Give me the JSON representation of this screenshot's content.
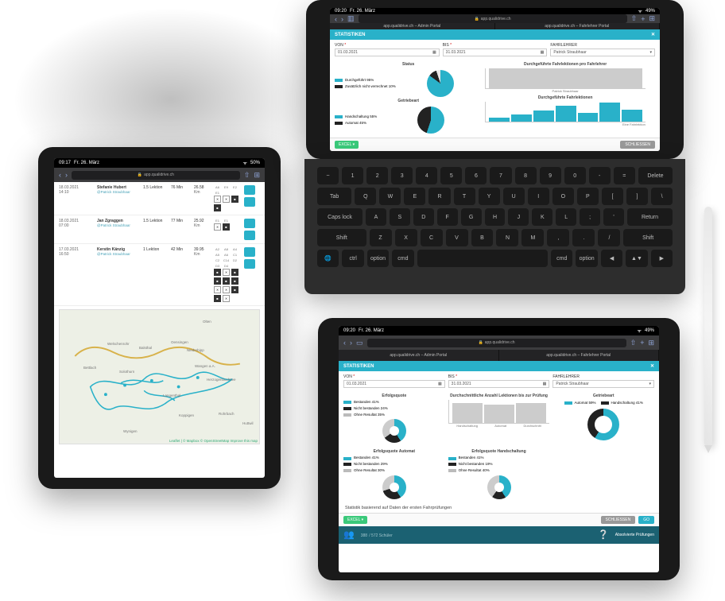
{
  "statusbar": {
    "time": "09:17",
    "time2": "09:20",
    "date": "Fr. 26. März",
    "battery": "50%",
    "battery2": "49%"
  },
  "safari": {
    "url": "app.qualidrive.ch",
    "tab_admin": "app.qualidrive.ch – Admin Portal",
    "tab_lehrer": "app.qualidrive.ch – Fahrlehrer Portal"
  },
  "stats_header": "STATISTIKEN",
  "filters": {
    "von_label": "VON",
    "von_value": "01.03.2021",
    "bis_label": "BIS",
    "bis_value": "31.03.2021",
    "lehrer_label": "FAHRLEHRER",
    "lehrer_value": "Patrick Straubhaar"
  },
  "top_panels": {
    "status_title": "Status",
    "status_legend": [
      {
        "label": "Durchgeführt",
        "pct": "95%",
        "color": "cyan"
      },
      {
        "label": "Zusätzlich nicht verrechnet",
        "pct": "10%",
        "color": "black"
      }
    ],
    "getriebe_title": "Getriebeart",
    "getriebe_legend": [
      {
        "label": "Handschaltung",
        "pct": "55%",
        "color": "cyan"
      },
      {
        "label": "Automat",
        "pct": "45%",
        "color": "black"
      }
    ],
    "chart1_title": "Durchgeführte Fahrlektionen pro Fahrlehrer",
    "chart1_x": "Patrick Straubhaar",
    "chart2_title": "Durchgeführte Fahrlektionen",
    "chart2_footer": "Eine Fahrlektion"
  },
  "bottom_panels": {
    "erfolg_title": "Erfolgsquote",
    "erfolg_legend": [
      {
        "label": "Bestanden",
        "pct": "41%",
        "color": "cyan"
      },
      {
        "label": "Nicht bestanden",
        "pct": "24%",
        "color": "black"
      },
      {
        "label": "Ohne Resultat",
        "pct": "35%",
        "color": "gray"
      }
    ],
    "lekt_title": "Durchschnittliche Anzahl Lektionen bis zur Prüfung",
    "lekt_cats": [
      "Handschaltung",
      "Automat",
      "Durchschnitt"
    ],
    "getriebe_title": "Getriebeart",
    "getriebe_legend": [
      {
        "label": "Automat",
        "pct": "59%",
        "color": "cyan"
      },
      {
        "label": "Handschaltung",
        "pct": "41%",
        "color": "black"
      }
    ],
    "auto_title": "Erfolgsquote Automat",
    "auto_legend": [
      {
        "label": "Bestanden",
        "pct": "41%",
        "color": "cyan"
      },
      {
        "label": "Nicht bestanden",
        "pct": "29%",
        "color": "black"
      },
      {
        "label": "Ohne Resultat",
        "pct": "30%",
        "color": "gray"
      }
    ],
    "hand_title": "Erfolgsquote Handschaltung",
    "hand_legend": [
      {
        "label": "Bestanden",
        "pct": "41%",
        "color": "cyan"
      },
      {
        "label": "Nicht bestanden",
        "pct": "19%",
        "color": "black"
      },
      {
        "label": "Ohne Resultat",
        "pct": "40%",
        "color": "gray"
      }
    ],
    "note": "Statistik basierend auf Daten der ersten Fahrprüfungen"
  },
  "buttons": {
    "excel": "EXCEL ▾",
    "close": "SCHLIESSEN",
    "go": "GO"
  },
  "appbar": {
    "count": "388",
    "total": "/ 572 Schüler",
    "menu": "Absolvierte Prüfungen"
  },
  "lessons": [
    {
      "date": "18.03.2021",
      "time": "14:10",
      "student": "Stefanie Hubert",
      "teacher": "@Patrick Straubhaar",
      "type": "1.5 Lektion",
      "duration": "76 Min",
      "price": "26.58",
      "unit": "Km",
      "codes": [
        "A6",
        "E9",
        "E2",
        "E1"
      ],
      "filled": [
        0,
        0,
        1,
        1
      ]
    },
    {
      "date": "18.03.2021",
      "time": "07:00",
      "student": "Jan Zgraggen",
      "teacher": "@Patrick Straubhaar",
      "type": "1.5 Lektion",
      "duration": "77 Min",
      "price": "25.92",
      "unit": "Km",
      "codes": [
        "E1",
        "E1"
      ],
      "filled": [
        0,
        1
      ]
    },
    {
      "date": "17.03.2021",
      "time": "16:50",
      "student": "Kerstin Känzig",
      "teacher": "@Patrick Straubhaar",
      "type": "1 Lektion",
      "duration": "42 Min",
      "price": "39.95",
      "unit": "Km",
      "codes": [
        "A2",
        "A8",
        "A4",
        "A5",
        "A6",
        "C1",
        "C2",
        "C14",
        "D2",
        "D3",
        "D4"
      ],
      "filled": [
        1,
        0,
        1,
        1,
        1,
        1,
        0,
        0,
        1,
        1,
        0
      ]
    }
  ],
  "map": {
    "cities": [
      "Olten",
      "Oensingen",
      "Niederbipp",
      "Wangen a.A.",
      "Herzogenbuchsee",
      "Langenthal",
      "Solothurn",
      "Welschenrohr",
      "Balsthal",
      "Bettlach",
      "Wynigen",
      "Huttwil",
      "Rohrbach",
      "Koppigen"
    ],
    "attribution": "Leaflet | © Mapbox © OpenStreetMap Improve this map"
  },
  "keyboard": {
    "r1": [
      "~",
      "1",
      "2",
      "3",
      "4",
      "5",
      "6",
      "7",
      "8",
      "9",
      "0",
      "-",
      "=",
      "Delete"
    ],
    "r2": [
      "Tab",
      "Q",
      "W",
      "E",
      "R",
      "T",
      "Y",
      "U",
      "I",
      "O",
      "P",
      "[",
      "]",
      "\\"
    ],
    "r3": [
      "Caps lock",
      "A",
      "S",
      "D",
      "F",
      "G",
      "H",
      "J",
      "K",
      "L",
      ";",
      "'",
      "Return"
    ],
    "r4": [
      "Shift",
      "Z",
      "X",
      "C",
      "V",
      "B",
      "N",
      "M",
      ",",
      ".",
      "/",
      "Shift"
    ],
    "r5": [
      "🌐",
      "ctrl",
      "option",
      "cmd",
      "",
      "cmd",
      "option",
      "◀",
      "▲▼",
      "▶"
    ]
  },
  "chart_data": [
    {
      "type": "pie",
      "title": "Status",
      "series": [
        {
          "name": "Durchgeführt",
          "value": 95
        },
        {
          "name": "Zusätzlich nicht verrechnet",
          "value": 10
        }
      ]
    },
    {
      "type": "pie",
      "title": "Getriebeart (top)",
      "series": [
        {
          "name": "Handschaltung",
          "value": 55
        },
        {
          "name": "Automat",
          "value": 45
        }
      ]
    },
    {
      "type": "bar",
      "title": "Durchgeführte Fahrlektionen pro Fahrlehrer",
      "categories": [
        "Patrick Straubhaar"
      ],
      "values": [
        100
      ],
      "ylim": [
        0,
        100
      ]
    },
    {
      "type": "bar",
      "title": "Durchgeführte Fahrlektionen",
      "categories": [
        "",
        "",
        "",
        "",
        "",
        "",
        ""
      ],
      "values": [
        20,
        35,
        55,
        80,
        45,
        95,
        60
      ]
    },
    {
      "type": "pie",
      "title": "Erfolgsquote",
      "series": [
        {
          "name": "Bestanden",
          "value": 41
        },
        {
          "name": "Nicht bestanden",
          "value": 24
        },
        {
          "name": "Ohne Resultat",
          "value": 35
        }
      ]
    },
    {
      "type": "bar",
      "title": "Durchschnittliche Anzahl Lektionen bis zur Prüfung",
      "categories": [
        "Handschaltung",
        "Automat",
        "Durchschnitt"
      ],
      "values": [
        13,
        12,
        13
      ],
      "ylim": [
        0,
        15
      ]
    },
    {
      "type": "pie",
      "title": "Getriebeart (bottom)",
      "series": [
        {
          "name": "Automat",
          "value": 59
        },
        {
          "name": "Handschaltung",
          "value": 41
        }
      ]
    },
    {
      "type": "pie",
      "title": "Erfolgsquote Automat",
      "series": [
        {
          "name": "Bestanden",
          "value": 41
        },
        {
          "name": "Nicht bestanden",
          "value": 29
        },
        {
          "name": "Ohne Resultat",
          "value": 30
        }
      ]
    },
    {
      "type": "pie",
      "title": "Erfolgsquote Handschaltung",
      "series": [
        {
          "name": "Bestanden",
          "value": 41
        },
        {
          "name": "Nicht bestanden",
          "value": 19
        },
        {
          "name": "Ohne Resultat",
          "value": 40
        }
      ]
    }
  ]
}
